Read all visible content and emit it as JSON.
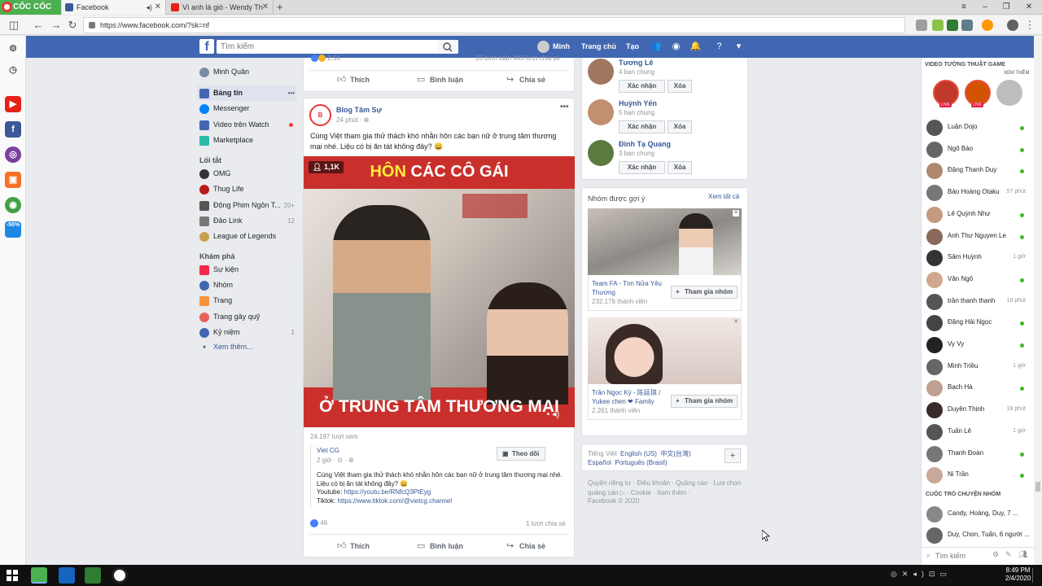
{
  "browser": {
    "brand": "CỐC CỐC",
    "tabs": [
      {
        "title": "Facebook",
        "active": true,
        "color": "#3b5998"
      },
      {
        "title": "Vì anh là gió - Wendy Th",
        "active": false,
        "color": "#e62117"
      }
    ],
    "url": "https://www.facebook.com/?sk=nf"
  },
  "fb": {
    "logo": "f",
    "search_placeholder": "Tìm kiếm",
    "user": "Minh",
    "home": "Trang chủ",
    "create": "Tạo"
  },
  "leftnav": {
    "profile": "Minh Quân",
    "main": [
      {
        "label": "Bảng tin",
        "color": "#4267b2",
        "more": "•••"
      },
      {
        "label": "Messenger",
        "color": "#0084ff"
      },
      {
        "label": "Video trên Watch",
        "color": "#4267b2"
      },
      {
        "label": "Marketplace",
        "color": "#2abba7"
      }
    ],
    "shortcuts_title": "Lối tắt",
    "shortcuts": [
      {
        "label": "OMG",
        "color": "#333",
        "count": ""
      },
      {
        "label": "Thug Life",
        "color": "#b71c1c",
        "count": ""
      },
      {
        "label": "Động Phim Ngôn T...",
        "color": "#555",
        "count": "20+"
      },
      {
        "label": "Đảo Link",
        "color": "#777",
        "count": "12"
      },
      {
        "label": "League of Legends",
        "color": "#c8a050",
        "count": ""
      }
    ],
    "explore_title": "Khám phá",
    "explore": [
      {
        "label": "Sự kiện",
        "color": "#f02849",
        "count": ""
      },
      {
        "label": "Nhóm",
        "color": "#4267b2",
        "count": ""
      },
      {
        "label": "Trang",
        "color": "#f7923b",
        "count": ""
      },
      {
        "label": "Trang gây quỹ",
        "color": "#e8625a",
        "count": ""
      },
      {
        "label": "Kỷ niệm",
        "color": "#4267b2",
        "count": "1"
      }
    ],
    "see_more": "Xem thêm..."
  },
  "feed": {
    "top_card": {
      "reactions": "2,5K",
      "comments_shares": "33 bình luận  443 lượt chia sẻ",
      "like": "Thích",
      "comment": "Bình luận",
      "share": "Chia sẻ"
    },
    "post": {
      "page": "Blog Tâm Sự",
      "time": "24 phút",
      "text": "Cùng Việt tham gia thử thách khó nhằn hôn các bạn nữ ở trung tâm thương mại nhé. Liệu có bị ăn tát không đây? 😄",
      "video_viewers": "1,1K",
      "video_title_a": "HÔN",
      "video_title_b": "CÁC CÔ GÁI",
      "video_caption": "Ở TRUNG TÂM THƯƠNG MẠI",
      "views": "24.197 lượt xem",
      "shared_page": "Viet CG",
      "shared_time": "2 giờ",
      "follow": "Theo dõi",
      "shared_text": "Cùng Việt tham gia thử thách khó nhằn hôn các bạn nữ ở trung tâm thương mại nhé. Liệu có bị ăn tát không đây? 😄",
      "youtube_label": "Youtube:",
      "youtube_url": "https://youtu.be/RNfcQ3PtEyg",
      "tiktok_label": "Tiktok:",
      "tiktok_url": "https://www.tiktok.com/@vietcg.channel",
      "reactions": "46",
      "shares": "1 lượt chia sẻ",
      "like": "Thích",
      "comment": "Bình luận",
      "share": "Chia sẻ"
    }
  },
  "right": {
    "friend_requests": [
      {
        "name": "Tương Lê",
        "mutual": "4 bạn chung",
        "color": "#a07860"
      },
      {
        "name": "Huỳnh Yến",
        "mutual": "5 bạn chung",
        "color": "#c09070"
      },
      {
        "name": "Đình Tạ Quang",
        "mutual": "3 bạn chung",
        "color": "#5a7a40"
      }
    ],
    "confirm": "Xác nhận",
    "delete": "Xóa",
    "groups_title": "Nhóm được gợi ý",
    "see_all": "Xem tất cả",
    "groups": [
      {
        "name": "Team FA - Tìm Nửa Yêu Thương",
        "members": "232.176 thành viên"
      },
      {
        "name": "Trần Ngọc Kỳ - 陈廷琪 / Yukee chen ❤ Family",
        "members": "2.261 thành viên"
      }
    ],
    "join": "Tham gia nhóm",
    "languages": [
      "Tiếng Việt",
      "English (US)",
      "中文(台灣)",
      "Español",
      "Português (Brasil)"
    ],
    "footer_links": "Quyền riêng tư · Điều khoản · Quảng cáo · Lựa chọn quảng cáo ▷ · Cookie · Xem thêm ·",
    "copyright": "Facebook © 2020"
  },
  "chat": {
    "game_title": "VIDEO TƯỜNG THUẬT GAME",
    "see_more": "XEM THÊM",
    "live": "LIVE",
    "contacts": [
      {
        "name": "Luận Dojo",
        "status": "",
        "color": "#555"
      },
      {
        "name": "Ngô Bảo",
        "status": "",
        "color": "#666"
      },
      {
        "name": "Đặng Thanh Duy",
        "status": "",
        "color": "#b08870"
      },
      {
        "name": "Bảo Hoàng Otaku",
        "status": "57 phút",
        "color": "#777"
      },
      {
        "name": "Lê Quỳnh Như",
        "status": "",
        "color": "#c49a80"
      },
      {
        "name": "Anh Thư Nguyen Le",
        "status": "",
        "color": "#8a6a5a"
      },
      {
        "name": "Sâm Huỳnh",
        "status": "1 giờ",
        "color": "#333"
      },
      {
        "name": "Vân Ngô",
        "status": "",
        "color": "#d0a890"
      },
      {
        "name": "trần thanh thanh",
        "status": "18 phút",
        "color": "#555"
      },
      {
        "name": "Đặng Hải Ngọc",
        "status": "",
        "color": "#444"
      },
      {
        "name": "Vy Vy",
        "status": "",
        "color": "#222"
      },
      {
        "name": "Minh Triều",
        "status": "1 giờ",
        "color": "#666"
      },
      {
        "name": "Bạch Hà",
        "status": "",
        "color": "#c0a090"
      },
      {
        "name": "Duyên Thịnh",
        "status": "18 phút",
        "color": "#3a2a2a"
      },
      {
        "name": "Tuấn Lê",
        "status": "1 giờ",
        "color": "#555"
      },
      {
        "name": "Thanh Đoàn",
        "status": "",
        "color": "#777"
      },
      {
        "name": "Ni Trần",
        "status": "",
        "color": "#c8a898"
      }
    ],
    "groups_title": "CUỘC TRÒ CHUYỆN NHÓM",
    "groups": [
      "Candy, Hoàng, Duy, 7 ...",
      "Duy, Chon, Tuấn, 6 người ..."
    ],
    "search_placeholder": "Tìm kiếm"
  },
  "taskbar": {
    "time": "8:49 PM",
    "date": "2/4/2020"
  }
}
